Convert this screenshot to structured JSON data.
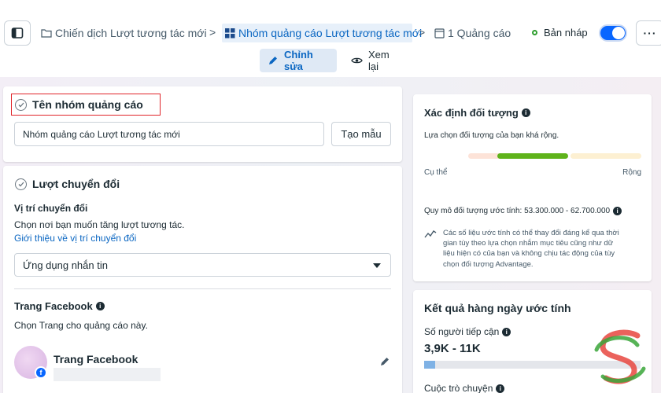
{
  "breadcrumb": {
    "campaign": "Chiến dịch Lượt tương tác mới",
    "adset": "Nhóm quảng cáo Lượt tương tác mới",
    "ads": "1 Quảng cáo"
  },
  "status": {
    "label": "Bản nháp",
    "toggle_on": true
  },
  "tabs": {
    "edit": "Chỉnh sửa",
    "review": "Xem lại"
  },
  "adset_name": {
    "title": "Tên nhóm quảng cáo",
    "value": "Nhóm quảng cáo Lượt tương tác mới",
    "template_button": "Tạo mẫu"
  },
  "conversion": {
    "title": "Lượt chuyển đổi",
    "location_label": "Vị trí chuyển đổi",
    "location_desc": "Chọn nơi bạn muốn tăng lượt tương tác.",
    "location_link": "Giới thiệu về vị trí chuyển đổi",
    "selected": "Ứng dụng nhắn tin"
  },
  "facebook_page": {
    "title": "Trang Facebook",
    "desc": "Chọn Trang cho quảng cáo này.",
    "page_name": "Trang Facebook"
  },
  "audience": {
    "title": "Xác định đối tượng",
    "desc": "Lựa chọn đối tượng của bạn khá rộng.",
    "specific": "Cụ thể",
    "broad": "Rộng",
    "size": "Quy mô đối tượng ước tính: 53.300.000 - 62.700.000",
    "note": [
      "Các số liệu ước tính có thể thay đổi đáng kể qua thời",
      "gian tùy theo lựa chọn nhắm mục tiêu cũng như dữ",
      "liệu hiện có của bạn và không chịu tác động của tùy",
      "chọn đối tượng Advantage."
    ]
  },
  "daily_results": {
    "title": "Kết quả hàng ngày ước tính",
    "reach_label": "Số người tiếp cận",
    "reach_value": "3,9K - 11K",
    "reach_fill_fraction": 0.05,
    "conversations_label": "Cuộc trò chuyện"
  },
  "colors": {
    "accent": "#0866ff",
    "link": "#0a66c2",
    "highlight_border": "#e0242a",
    "meter_low": "#fde3d8",
    "meter_mid": "#5fb31b",
    "meter_high": "#fdf0d2"
  }
}
